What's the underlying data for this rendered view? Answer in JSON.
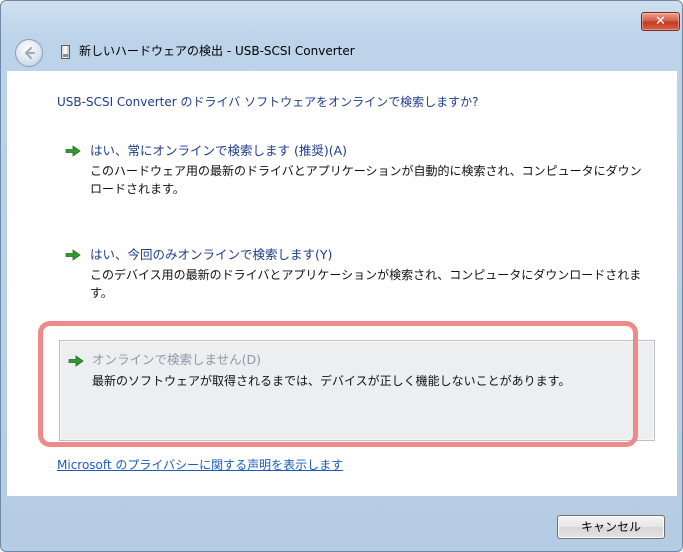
{
  "window": {
    "title": "新しいハードウェアの検出 - USB-SCSI Converter",
    "close_label": "✕"
  },
  "dialog": {
    "question": "USB-SCSI Converter のドライバ ソフトウェアをオンラインで検索しますか?",
    "options": [
      {
        "title": "はい、常にオンラインで検索します (推奨)(A)",
        "description": "このハードウェア用の最新のドライバとアプリケーションが自動的に検索され、コンピュータにダウンロードされます。",
        "icon": "green-arrow-icon"
      },
      {
        "title": "はい、今回のみオンラインで検索します(Y)",
        "description": "このデバイス用の最新のドライバとアプリケーションが検索され、コンピュータにダウンロードされます。",
        "icon": "green-arrow-icon"
      },
      {
        "title": "オンラインで検索しません(D)",
        "description": "最新のソフトウェアが取得されるまでは、デバイスが正しく機能しないことがあります。",
        "icon": "green-arrow-icon"
      }
    ],
    "privacy_link": "Microsoft のプライバシーに関する声明を表示します",
    "cancel_label": "キャンセル"
  },
  "colors": {
    "accent_text": "#1f3c8c",
    "link": "#1b5bbd",
    "highlight_border": "#f08a8a",
    "arrow_green": "#2f9a2f",
    "close_red": "#c23a22"
  }
}
